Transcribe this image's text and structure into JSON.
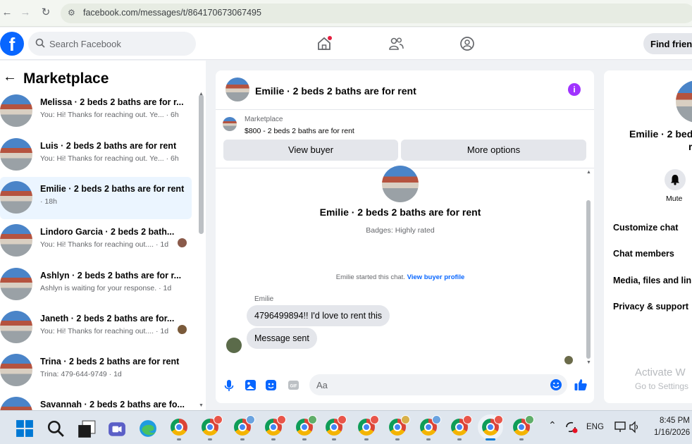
{
  "browser": {
    "url": "facebook.com/messages/t/864170673067495"
  },
  "header": {
    "search_placeholder": "Search Facebook",
    "find_friends": "Find friend",
    "logo": "f"
  },
  "sidebar": {
    "title": "Marketplace",
    "conversations": [
      {
        "name": "Melissa · 2 beds 2 baths are for r...",
        "preview": "You: Hi! Thanks for reaching out. Ye... · 6h",
        "active": false
      },
      {
        "name": "Luis · 2 beds 2 baths are for rent",
        "preview": "You: Hi! Thanks for reaching out. Ye... · 6h",
        "active": false
      },
      {
        "name": "Emilie · 2 beds 2 baths are for rent",
        "preview": "· 18h",
        "active": true
      },
      {
        "name": "Lindoro Garcia · 2 beds 2 bath...",
        "preview": "You: Hi! Thanks for reaching out.... · 1d",
        "active": false
      },
      {
        "name": "Ashlyn · 2 beds 2 baths are for r...",
        "preview": "Ashlyn is waiting for your response. · 1d",
        "active": false
      },
      {
        "name": "Janeth · 2 beds 2 baths are for...",
        "preview": "You: Hi! Thanks for reaching out.... · 1d",
        "active": false
      },
      {
        "name": "Trina · 2 beds 2 baths are for rent",
        "preview": "Trina: 479-644-9749 · 1d",
        "active": false
      },
      {
        "name": "Savannah · 2 beds 2 baths are fo...",
        "preview": "",
        "active": false
      }
    ]
  },
  "chat": {
    "title": "Emilie · 2 beds 2 baths are for rent",
    "listing_category": "Marketplace",
    "listing_price": "$800 - 2 beds 2 baths are for rent",
    "view_buyer": "View buyer",
    "more_options": "More options",
    "profile_name": "Emilie · 2 beds 2 baths are for rent",
    "badges": "Badges: Highly rated",
    "started_text": "Emilie started this chat.",
    "view_buyer_profile": "View buyer profile",
    "sender": "Emilie",
    "messages": [
      "4796499894!! I'd love to rent this",
      "Message sent"
    ],
    "input_placeholder": "Aa"
  },
  "details": {
    "name_line1": "Emilie · 2 bed",
    "name_line2": "r",
    "mute": "Mute",
    "items": [
      "Customize chat",
      "Chat members",
      "Media, files and link",
      "Privacy & support"
    ],
    "activate_line1": "Activate W",
    "activate_line2": "Go to Settings"
  },
  "taskbar": {
    "time": "8:45 PM",
    "date": "1/16/2026",
    "language": "ENG"
  },
  "colors": {
    "brand": "#0866ff",
    "info": "#a033ff",
    "active_row": "#ebf5ff"
  },
  "icons": [
    "back-arrow-icon",
    "forward-arrow-icon",
    "reload-icon",
    "site-info-icon",
    "search-icon",
    "home-icon",
    "friends-icon",
    "profile-icon",
    "info-icon",
    "mic-icon",
    "image-icon",
    "sticker-icon",
    "gif-icon",
    "emoji-icon",
    "like-icon",
    "bell-icon",
    "windows-start-icon",
    "taskbar-search-icon",
    "chrome-icon"
  ]
}
